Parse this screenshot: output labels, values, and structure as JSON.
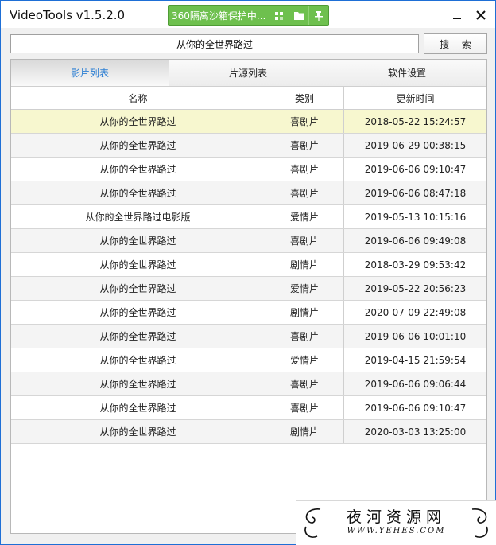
{
  "window": {
    "title": "VideoTools v1.5.2.0",
    "accent": "#1e6fd6"
  },
  "sandbox": {
    "label": "360隔离沙箱保护中...",
    "color": "#6ec04e",
    "buttons": [
      "sandbox-icon",
      "folder-icon",
      "pin-icon"
    ]
  },
  "search": {
    "value": "从你的全世界路过",
    "button_label": "搜 索"
  },
  "tabs": [
    {
      "label": "影片列表",
      "active": true
    },
    {
      "label": "片源列表",
      "active": false
    },
    {
      "label": "软件设置",
      "active": false
    }
  ],
  "table": {
    "columns": [
      "名称",
      "类别",
      "更新时间"
    ],
    "rows": [
      {
        "name": "从你的全世界路过",
        "type": "喜剧片",
        "time": "2018-05-22 15:24:57"
      },
      {
        "name": "从你的全世界路过",
        "type": "喜剧片",
        "time": "2019-06-29 00:38:15"
      },
      {
        "name": "从你的全世界路过",
        "type": "喜剧片",
        "time": "2019-06-06 09:10:47"
      },
      {
        "name": "从你的全世界路过",
        "type": "喜剧片",
        "time": "2019-06-06 08:47:18"
      },
      {
        "name": "从你的全世界路过电影版",
        "type": "爱情片",
        "time": "2019-05-13 10:15:16"
      },
      {
        "name": "从你的全世界路过",
        "type": "喜剧片",
        "time": "2019-06-06 09:49:08"
      },
      {
        "name": "从你的全世界路过",
        "type": "剧情片",
        "time": "2018-03-29 09:53:42"
      },
      {
        "name": "从你的全世界路过",
        "type": "爱情片",
        "time": "2019-05-22 20:56:23"
      },
      {
        "name": "从你的全世界路过",
        "type": "剧情片",
        "time": "2020-07-09 22:49:08"
      },
      {
        "name": "从你的全世界路过",
        "type": "喜剧片",
        "time": "2019-06-06 10:01:10"
      },
      {
        "name": "从你的全世界路过",
        "type": "爱情片",
        "time": "2019-04-15 21:59:54"
      },
      {
        "name": "从你的全世界路过",
        "type": "喜剧片",
        "time": "2019-06-06 09:06:44"
      },
      {
        "name": "从你的全世界路过",
        "type": "喜剧片",
        "time": "2019-06-06 09:10:47"
      },
      {
        "name": "从你的全世界路过",
        "type": "剧情片",
        "time": "2020-03-03 13:25:00"
      }
    ]
  },
  "watermark": {
    "title": "夜河资源网",
    "url": "WWW.YEHES.COM"
  }
}
